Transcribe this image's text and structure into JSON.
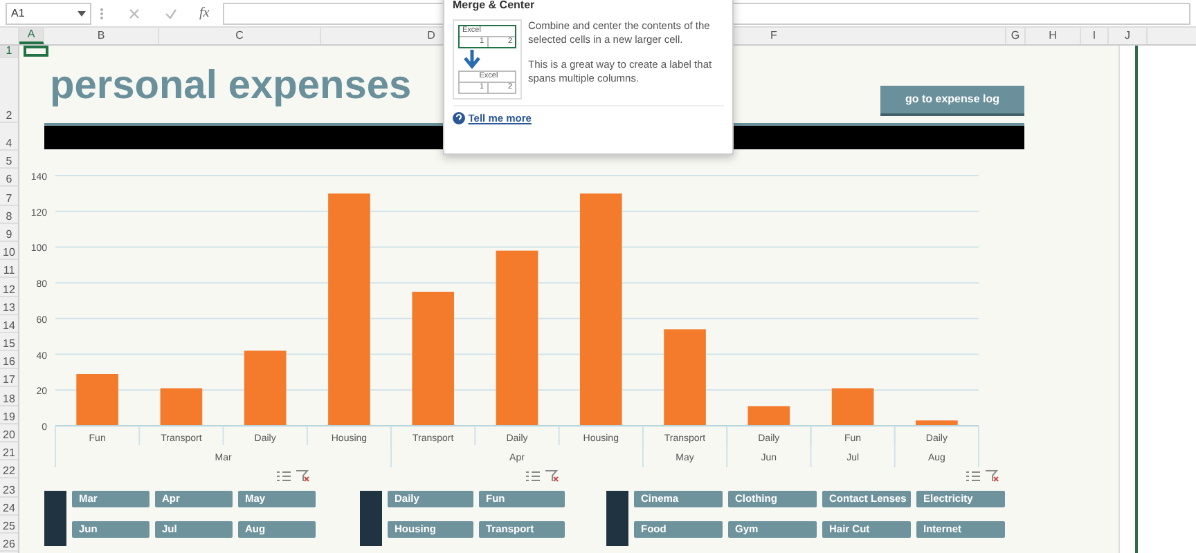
{
  "formula_bar": {
    "name_box": "A1",
    "function_label": "fx"
  },
  "columns": [
    {
      "label": "A",
      "selected": true
    },
    {
      "label": "B",
      "selected": false
    },
    {
      "label": "C",
      "selected": false
    },
    {
      "label": "D",
      "selected": false
    },
    {
      "label": "F",
      "selected": false
    },
    {
      "label": "G",
      "selected": false
    },
    {
      "label": "H",
      "selected": false
    },
    {
      "label": "I",
      "selected": false
    },
    {
      "label": "J",
      "selected": false
    }
  ],
  "rows": [
    {
      "label": "1",
      "selected": true
    },
    {
      "label": "2",
      "selected": false
    },
    {
      "label": "4",
      "selected": false
    },
    {
      "label": "5",
      "selected": false
    },
    {
      "label": "6",
      "selected": false
    },
    {
      "label": "7",
      "selected": false
    },
    {
      "label": "8",
      "selected": false
    },
    {
      "label": "9",
      "selected": false
    },
    {
      "label": "10",
      "selected": false
    },
    {
      "label": "11",
      "selected": false
    },
    {
      "label": "12",
      "selected": false
    },
    {
      "label": "13",
      "selected": false
    },
    {
      "label": "14",
      "selected": false
    },
    {
      "label": "15",
      "selected": false
    },
    {
      "label": "16",
      "selected": false
    },
    {
      "label": "17",
      "selected": false
    },
    {
      "label": "18",
      "selected": false
    },
    {
      "label": "19",
      "selected": false
    },
    {
      "label": "20",
      "selected": false
    },
    {
      "label": "21",
      "selected": false
    },
    {
      "label": "22",
      "selected": false
    },
    {
      "label": "23",
      "selected": false
    },
    {
      "label": "24",
      "selected": false
    },
    {
      "label": "25",
      "selected": false
    },
    {
      "label": "26",
      "selected": false
    }
  ],
  "sheet": {
    "title": "personal expenses",
    "button": "go to expense log",
    "chart_data": {
      "type": "bar",
      "series": [
        {
          "color": "#f47a2c",
          "values": [
            29,
            21,
            42,
            130,
            75,
            98,
            130,
            54,
            11,
            21,
            3
          ]
        }
      ],
      "grid": true,
      "ylim": [
        0,
        140
      ],
      "yticks": [
        0,
        20,
        40,
        60,
        80,
        100,
        120,
        140
      ]
    },
    "chart_axis_groups": [
      {
        "label": "Mar",
        "categories": [
          "Fun",
          "Transport",
          "Daily",
          "Housing"
        ]
      },
      {
        "label": "Apr",
        "categories": [
          "Transport",
          "Daily",
          "Housing"
        ]
      },
      {
        "label": "May",
        "categories": [
          "Transport"
        ]
      },
      {
        "label": "Jun",
        "categories": [
          "Daily"
        ]
      },
      {
        "label": "Jul",
        "categories": [
          "Fun"
        ]
      },
      {
        "label": "Aug",
        "categories": [
          "Daily"
        ]
      }
    ],
    "slicers": [
      {
        "items": [
          {
            "label": "Mar",
            "selected": true
          },
          {
            "label": "Apr",
            "selected": true
          },
          {
            "label": "May",
            "selected": true
          },
          {
            "label": "Jun",
            "selected": true
          },
          {
            "label": "Jul",
            "selected": true
          },
          {
            "label": "Aug",
            "selected": true
          }
        ]
      },
      {
        "items": [
          {
            "label": "Daily",
            "selected": true
          },
          {
            "label": "Fun",
            "selected": true
          },
          {
            "label": "Housing",
            "selected": true
          },
          {
            "label": "Transport",
            "selected": true
          }
        ]
      },
      {
        "items": [
          {
            "label": "Cinema",
            "selected": true
          },
          {
            "label": "Clothing",
            "selected": true
          },
          {
            "label": "Contact Lenses",
            "selected": true
          },
          {
            "label": "Electricity",
            "selected": true
          },
          {
            "label": "Food",
            "selected": true
          },
          {
            "label": "Gym",
            "selected": true
          },
          {
            "label": "Hair Cut",
            "selected": true
          },
          {
            "label": "Internet",
            "selected": true
          }
        ]
      }
    ]
  },
  "tooltip": {
    "title": "Merge & Center",
    "illustration": {
      "top_cells": [
        "Excel",
        "1",
        "2"
      ],
      "bottom_cells": [
        "Excel",
        "1",
        "2"
      ]
    },
    "paragraphs": [
      "Combine and center the contents of the selected cells in a new larger cell.",
      "This is a great way to create a label that spans multiple columns."
    ],
    "link": "Tell me more"
  }
}
